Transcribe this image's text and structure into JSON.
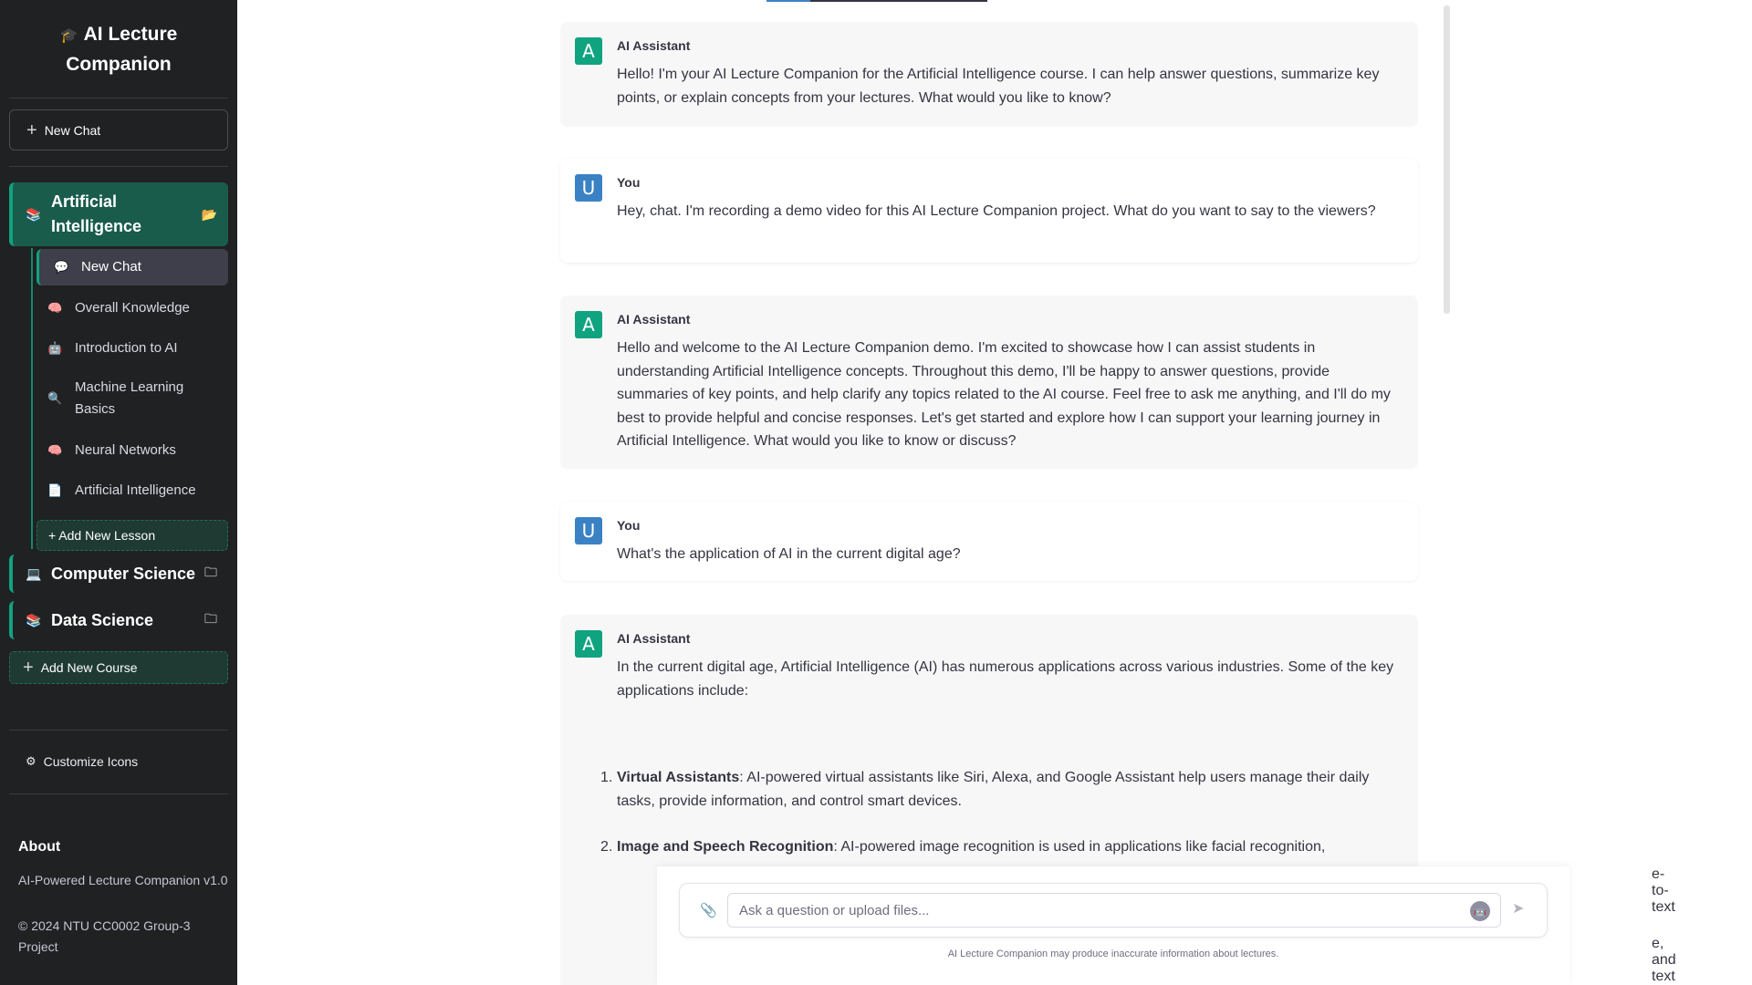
{
  "sidebar": {
    "brand_icon": "graduation-cap-icon",
    "brand_line1": "AI Lecture",
    "brand_line2": "Companion",
    "new_chat_label": "New Chat",
    "courses": [
      {
        "label": "Artificial Intelligence",
        "icon": "books-icon",
        "active": true
      },
      {
        "label": "Computer Science",
        "icon": "laptop-icon",
        "active": false
      },
      {
        "label": "Data Science",
        "icon": "books-icon",
        "active": false
      }
    ],
    "lessons": [
      {
        "label": "New Chat",
        "icon": "chat-icon",
        "active": true
      },
      {
        "label": "Overall Knowledge",
        "icon": "brain-icon"
      },
      {
        "label": "Introduction to AI",
        "icon": "robot-icon"
      },
      {
        "label": "Machine Learning Basics",
        "icon": "magnifier-icon"
      },
      {
        "label": "Neural Networks",
        "icon": "brain-icon"
      },
      {
        "label": "Artificial Intelligence",
        "icon": "document-icon"
      }
    ],
    "add_lesson_label": "+ Add New Lesson",
    "add_course_label": "Add New Course",
    "customize_label": "Customize Icons",
    "about": {
      "title": "About",
      "line1": "AI-Powered Lecture Companion v1.0",
      "line2": "© 2024 NTU CC0002 Group-3 Project"
    }
  },
  "chat": {
    "messages": [
      {
        "role": "assistant",
        "author": "AI Assistant",
        "avatar": "A",
        "text": "Hello! I'm your AI Lecture Companion for the Artificial Intelligence course. I can help answer questions, summarize key points, or explain concepts from your lectures. What would you like to know?"
      },
      {
        "role": "user",
        "author": "You",
        "avatar": "U",
        "text": "Hey, chat. I'm recording a demo video for this AI Lecture Companion project. What do you want to say to the viewers?"
      },
      {
        "role": "assistant",
        "author": "AI Assistant",
        "avatar": "A",
        "text": "Hello and welcome to the AI Lecture Companion demo. I'm excited to showcase how I can assist students in understanding Artificial Intelligence concepts. Throughout this demo, I'll be happy to answer questions, provide summaries of key points, and help clarify any topics related to the AI course. Feel free to ask me anything, and I'll do my best to provide helpful and concise responses. Let's get started and explore how I can support your learning journey in Artificial Intelligence. What would you like to know or discuss?"
      },
      {
        "role": "user",
        "author": "You",
        "avatar": "U",
        "text": "What's the application of AI in the current digital age?"
      },
      {
        "role": "assistant",
        "author": "AI Assistant",
        "avatar": "A",
        "text": "In the current digital age, Artificial Intelligence (AI) has numerous applications across various industries. Some of the key applications include:",
        "list": [
          {
            "num": "1.",
            "title": "Virtual Assistants",
            "text": ": AI-powered virtual assistants like Siri, Alexa, and Google Assistant help users manage their daily tasks, provide information, and control smart devices."
          },
          {
            "num": "2.",
            "title": "Image and Speech Recognition",
            "text": ": AI-powered image recognition is used in applications like facial recognition,"
          }
        ],
        "partial_right_1": "e-to-text",
        "partial_right_2": "e, and text"
      }
    ]
  },
  "input": {
    "placeholder": "Ask a question or upload files...",
    "value": "",
    "attach_icon": "paperclip-icon",
    "bot_icon": "bot-icon",
    "send_icon": "send-icon",
    "disclaimer": "AI Lecture Companion may produce inaccurate information about lectures."
  },
  "colors": {
    "sidebar_bg": "#202123",
    "accent": "#10a37f",
    "user_avatar": "#3b82c4",
    "assistant_bg": "#f7f7f8"
  }
}
